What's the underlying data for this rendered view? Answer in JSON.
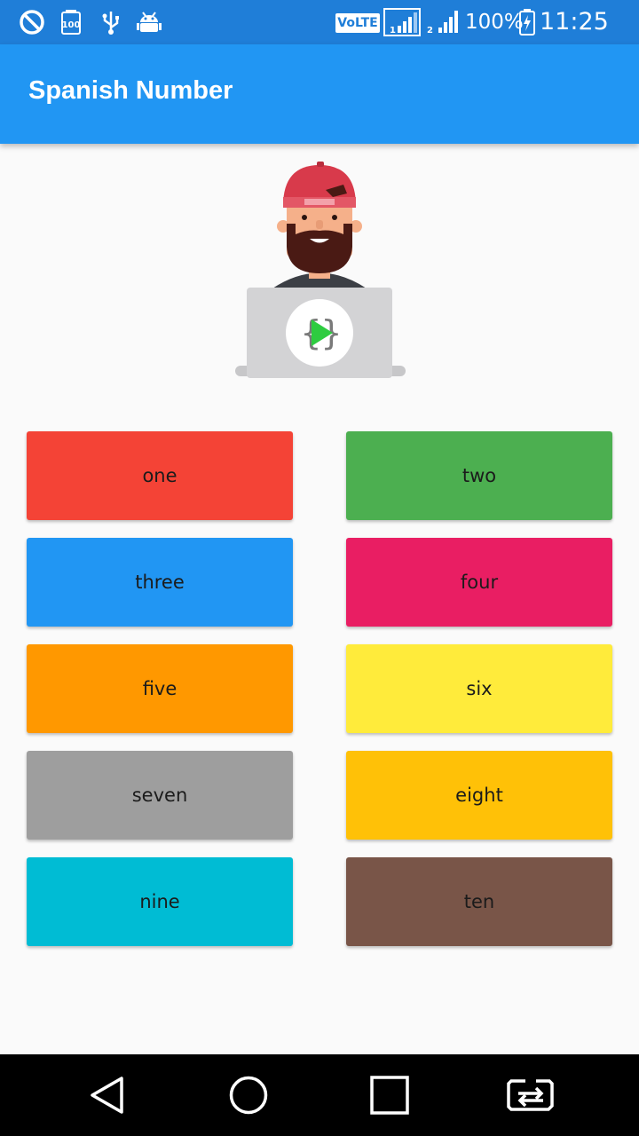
{
  "status_bar": {
    "icons": [
      "no-disturb-icon",
      "battery-100-icon",
      "usb-icon",
      "android-debug-icon",
      "signal-sim1-icon",
      "signal-sim2-icon",
      "battery-charging-icon"
    ],
    "volte": "VoLTE",
    "sim1": "1",
    "sim2": "2",
    "battery_percent": "100%",
    "battery_level": "100",
    "time": "11:25 pm"
  },
  "app_bar": {
    "title": "Spanish Number"
  },
  "hero": {
    "icon": "developer-illustration"
  },
  "buttons": [
    {
      "label": "one",
      "color": "#f44336"
    },
    {
      "label": "two",
      "color": "#4caf50"
    },
    {
      "label": "three",
      "color": "#2196f3"
    },
    {
      "label": "four",
      "color": "#e91e63"
    },
    {
      "label": "five",
      "color": "#ff9800"
    },
    {
      "label": "six",
      "color": "#ffeb3b"
    },
    {
      "label": "seven",
      "color": "#9e9e9e"
    },
    {
      "label": "eight",
      "color": "#ffc107"
    },
    {
      "label": "nine",
      "color": "#00bcd4"
    },
    {
      "label": "ten",
      "color": "#795548"
    }
  ],
  "nav_bar": {
    "icons": [
      "back-icon",
      "home-icon",
      "recents-icon",
      "switch-apps-icon"
    ]
  }
}
